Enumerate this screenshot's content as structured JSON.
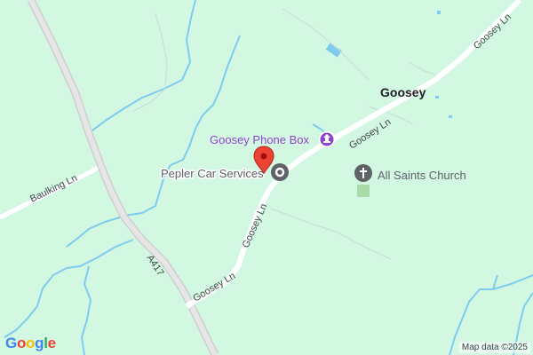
{
  "map": {
    "place_label": "Goosey",
    "roads": {
      "a417": "A417",
      "baulking_ln": "Baulking Ln",
      "goosey_ln_1": "Goosey Ln",
      "goosey_ln_2": "Goosey Ln",
      "goosey_ln_3": "Goosey Ln",
      "goosey_ln_4": "Goosey Ln"
    },
    "pois": {
      "phone_box": {
        "label": "Goosey Phone Box",
        "color": "#8e44c9",
        "icon": "landmark-icon"
      },
      "church": {
        "label": "All Saints Church",
        "color": "#5f6368",
        "icon": "cross-icon"
      },
      "car_services": {
        "label": "Pepler Car Services",
        "color": "#5f6368",
        "icon": "car-service-icon"
      }
    },
    "marker": {
      "color": "#ea4335",
      "icon": "map-pin-icon"
    },
    "colors": {
      "land": "#d3f8e2",
      "water": "#7ecbef",
      "road": "#ffffff",
      "major_road": "#d6d6d6"
    }
  },
  "footer": {
    "logo_letters": [
      "G",
      "o",
      "o",
      "g",
      "l",
      "e"
    ],
    "logo_colors": [
      "#4285f4",
      "#ea4335",
      "#fbbc05",
      "#4285f4",
      "#34a853",
      "#ea4335"
    ],
    "attribution": "Map data ©2025"
  }
}
